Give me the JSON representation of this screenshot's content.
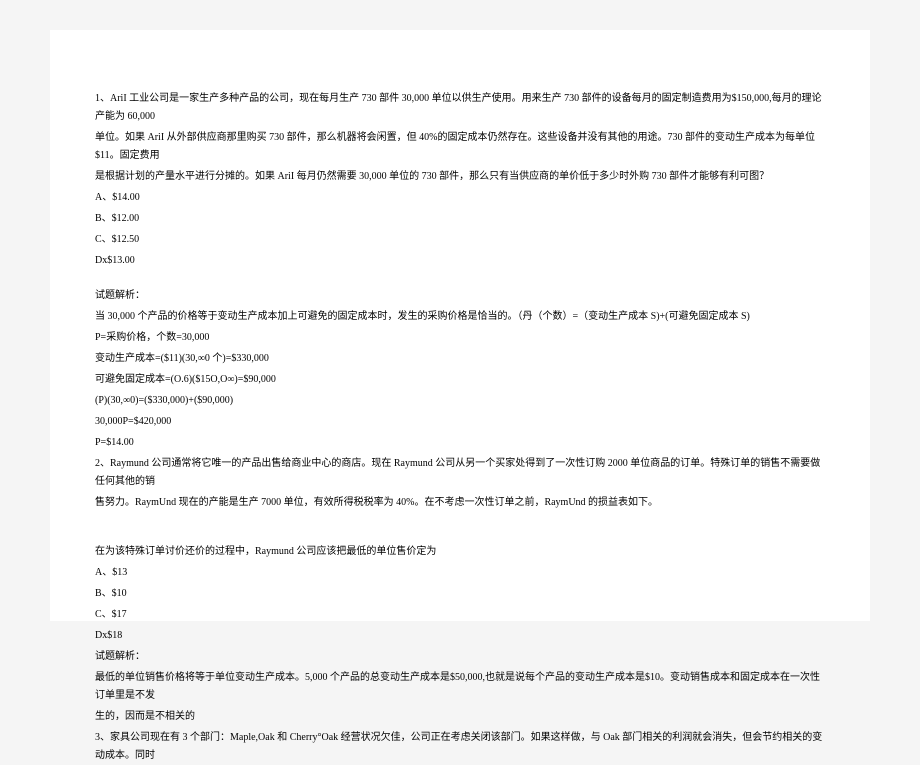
{
  "question1": {
    "text_line1": "1、AriI 工业公司是一家生产多种产品的公司，现在每月生产 730 部件 30,000 单位以供生产使用。用来生产 730 部件的设备每月的固定制造费用为$150,000,每月的理论产能为 60,000",
    "text_line2": "单位。如果 AriI 从外部供应商那里购买 730 部件，那么机器将会闲置，但 40%的固定成本仍然存在。这些设备并没有其他的用途。730 部件的变动生产成本为每单位$11。固定费用",
    "text_line3": "是根据计划的产量水平进行分摊的。如果 AriI 每月仍然需要 30,000 单位的 730 部件，那么只有当供应商的单价低于多少时外购 730 部件才能够有利可图？",
    "option_a": "A、$14.00",
    "option_b": "B、$12.00",
    "option_c": "C、$12.50",
    "option_d": "Dx$13.00",
    "analysis_label": "试题解析：",
    "analysis_line1": "当 30,000 个产品的价格等于变动生产成本加上可避免的固定成本时，发生的采购价格是恰当的。（丹（个数）=（变动生产成本 S)+(可避免固定成本 S)",
    "analysis_line2": "P=采购价格，个数=30,000",
    "analysis_line3": "变动生产成本=($11)(30,∞0 个)=$330,000",
    "analysis_line4": "可避免固定成本=(O.6)($15O,O∞)=$90,000",
    "analysis_line5": "(P)(30,∞0)=($330,000)+($90,000)",
    "analysis_line6": "30,000P=$420,000",
    "analysis_line7": "P=$14.00"
  },
  "question2": {
    "text_line1": "2、Raymund 公司通常将它唯一的产品出售给商业中心的商店。现在 Raymund 公司从另一个买家处得到了一次性订购 2000 单位商品的订单。特殊订单的销售不需要做任何其他的销",
    "text_line2": "售努力。RaymUnd 现在的产能是生产 7000 单位，有效所得税税率为 40%。在不考虑一次性订单之前，RaymUnd 的损益表如下。",
    "text_line3": "在为该特殊订单讨价还价的过程中，Raymund 公司应该把最低的单位售价定为",
    "option_a": "A、$13",
    "option_b": "B、$10",
    "option_c": "C、$17",
    "option_d": "Dx$18",
    "analysis_label": "试题解析：",
    "analysis_line1": "最低的单位销售价格将等于单位变动生产成本。5,000 个产品的总变动生产成本是$50,000,也就是说每个产品的变动生产成本是$10。变动销售成本和固定成本在一次性订单里是不发",
    "analysis_line2": "生的，因而是不相关的"
  },
  "question3": {
    "text_line1": "3、家具公司现在有 3 个部门：Maple,Oak 和 Cherry°Oak 经营状况欠佳，公司正在考虑关闭该部门。如果这样做，与 Oak 部门相关的利润就会消失，但会节约相关的变动成本。同时"
  }
}
